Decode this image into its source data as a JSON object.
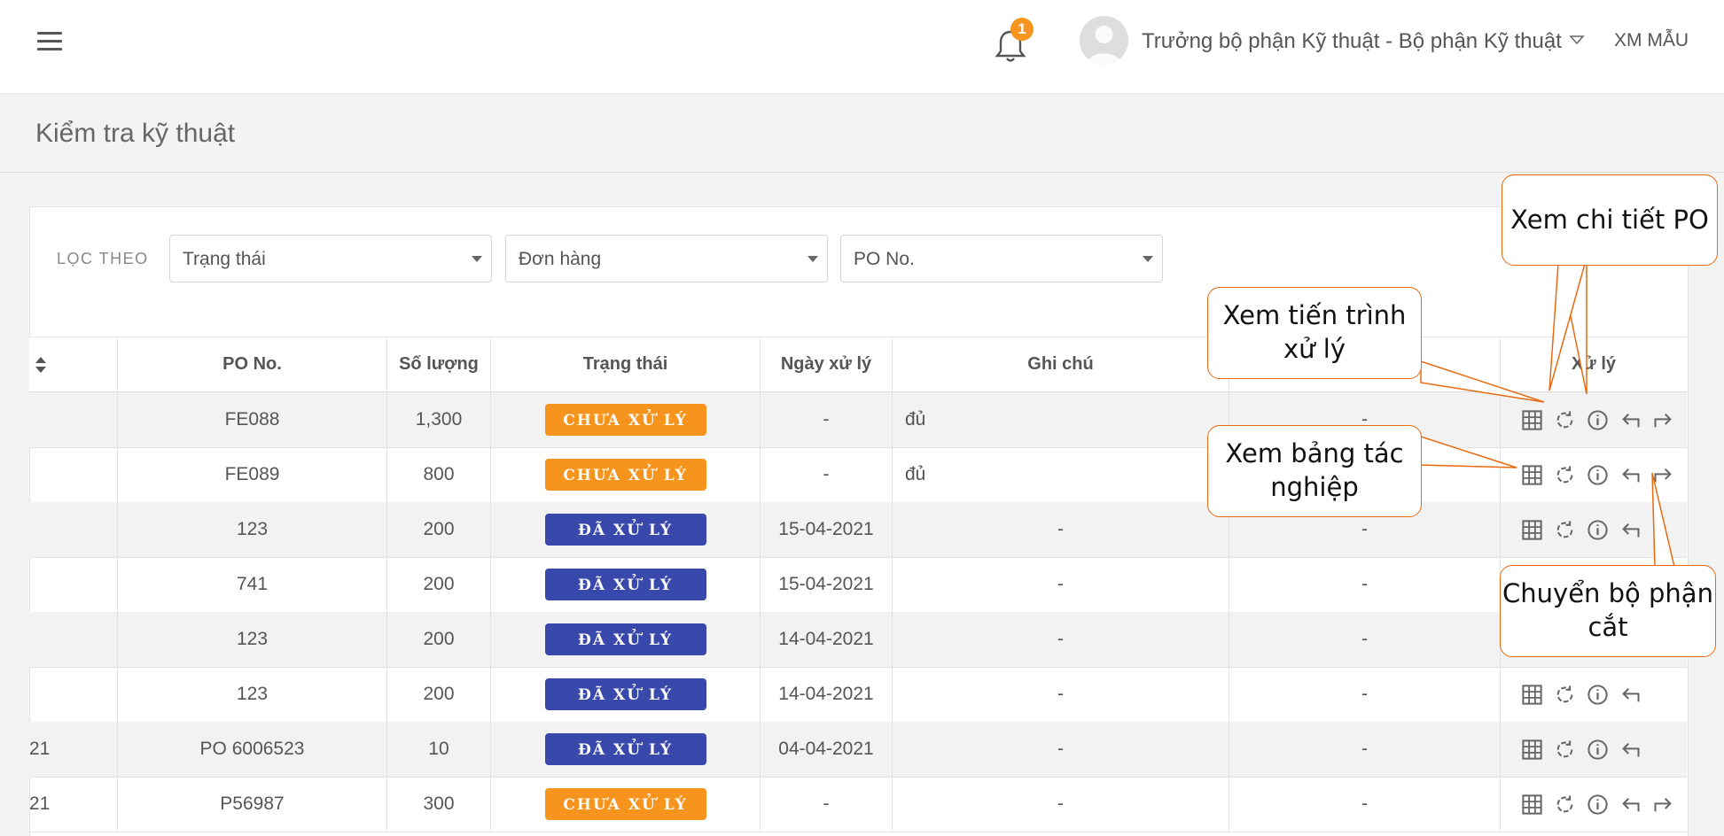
{
  "header": {
    "notification_count": "1",
    "user_role": "Trưởng bộ phận Kỹ thuật - Bộ phận Kỹ thuật",
    "company": "XM MẪU"
  },
  "page": {
    "title": "Kiểm tra kỹ thuật"
  },
  "filters": {
    "label": "LỌC THEO",
    "status": "Trạng thái",
    "order": "Đơn hàng",
    "po": "PO No."
  },
  "table": {
    "columns": [
      "PO No.",
      "Số lượng",
      "Trạng thái",
      "Ngày xử lý",
      "Ghi chú",
      "Xử lý"
    ],
    "rows": [
      {
        "first": "",
        "po": "FE088",
        "qty": "1,300",
        "status": "CHƯA XỬ LÝ",
        "date": "-",
        "note": "đủ",
        "extra": "-"
      },
      {
        "first": "",
        "po": "FE089",
        "qty": "800",
        "status": "CHƯA XỬ LÝ",
        "date": "-",
        "note": "đủ",
        "extra": "-"
      },
      {
        "first": "",
        "po": "123",
        "qty": "200",
        "status": "ĐÃ XỬ LÝ",
        "date": "15-04-2021",
        "note": "-",
        "extra": "-"
      },
      {
        "first": "",
        "po": "741",
        "qty": "200",
        "status": "ĐÃ XỬ LÝ",
        "date": "15-04-2021",
        "note": "-",
        "extra": "-"
      },
      {
        "first": "",
        "po": "123",
        "qty": "200",
        "status": "ĐÃ XỬ LÝ",
        "date": "14-04-2021",
        "note": "-",
        "extra": "-"
      },
      {
        "first": "",
        "po": "123",
        "qty": "200",
        "status": "ĐÃ XỬ LÝ",
        "date": "14-04-2021",
        "note": "-",
        "extra": "-"
      },
      {
        "first": "21",
        "po": "PO 6006523",
        "qty": "10",
        "status": "ĐÃ XỬ LÝ",
        "date": "04-04-2021",
        "note": "-",
        "extra": "-"
      },
      {
        "first": "21",
        "po": "P56987",
        "qty": "300",
        "status": "CHƯA XỬ LÝ",
        "date": "-",
        "note": "-",
        "extra": "-"
      }
    ]
  },
  "status_colors": {
    "pending": "#f7941d",
    "done": "#3949ab"
  },
  "callouts": {
    "view_po": "Xem chi tiết PO",
    "view_progress": "Xem tiến trình xử lý",
    "view_sheet": "Xem bảng tác nghiệp",
    "transfer": "Chuyển bộ phận cắt"
  },
  "icons": [
    "menu-icon",
    "bell-icon",
    "avatar-icon",
    "chevron-down-icon",
    "sort-icon",
    "grid-icon",
    "refresh-icon",
    "info-icon",
    "undo-icon",
    "forward-icon"
  ]
}
